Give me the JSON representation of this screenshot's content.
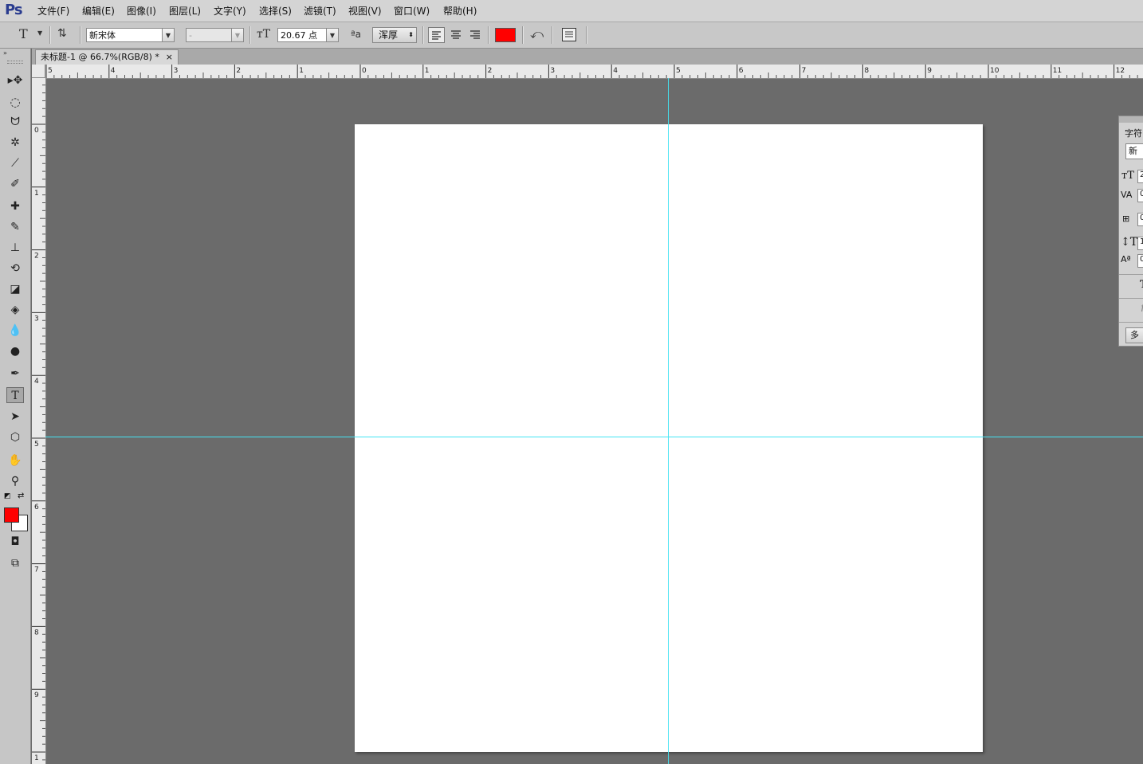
{
  "app": {
    "logo": "Ps"
  },
  "menu": [
    "文件(F)",
    "编辑(E)",
    "图像(I)",
    "图层(L)",
    "文字(Y)",
    "选择(S)",
    "滤镜(T)",
    "视图(V)",
    "窗口(W)",
    "帮助(H)"
  ],
  "options": {
    "tool_glyph": "T",
    "font_family": "新宋体",
    "font_style": "-",
    "font_size": "20.67 点",
    "aa_label": "ªa",
    "aa_mode": "浑厚",
    "text_color": "#ff0000"
  },
  "document": {
    "tab_title": "未标题-1 @ 66.7%(RGB/8) *",
    "close_glyph": "×"
  },
  "rulers": {
    "top_labels": [
      "5",
      "4",
      "3",
      "2",
      "1",
      "0",
      "1",
      "2",
      "3",
      "4",
      "5",
      "6",
      "7",
      "8",
      "9",
      "10",
      "11",
      "12"
    ],
    "left_labels": [
      "0",
      "1",
      "2",
      "3",
      "4",
      "5",
      "6",
      "7",
      "8",
      "9",
      "1"
    ]
  },
  "colors": {
    "foreground": "#ff0000",
    "background": "#ffffff",
    "guide": "#43e3f2",
    "workspace": "#6b6b6b"
  },
  "char_panel": {
    "title": "字符",
    "font_field": "新",
    "size_field": "2",
    "kerning_field": "0",
    "tracking_field": "0",
    "leading_field": "1",
    "baseline_field": "0",
    "faux_bold_glyph": "T",
    "ligature_glyph": "f",
    "language_btn": "多"
  }
}
